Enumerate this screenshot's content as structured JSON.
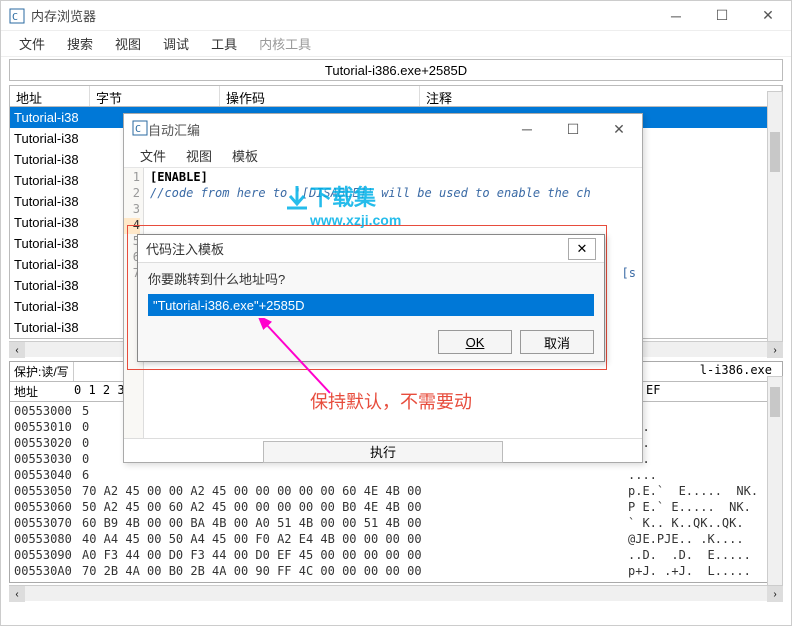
{
  "main_window": {
    "title": "内存浏览器",
    "menus": [
      "文件",
      "搜索",
      "视图",
      "调试",
      "工具",
      "内核工具"
    ],
    "subtitle": "Tutorial-i386.exe+2585D",
    "columns": {
      "addr": "地址",
      "bytes": "字节",
      "opcode": "操作码",
      "comment": "注释"
    },
    "rows": [
      "Tutorial-i38",
      "Tutorial-i38",
      "Tutorial-i38",
      "Tutorial-i38",
      "Tutorial-i38",
      "Tutorial-i38",
      "Tutorial-i38",
      "Tutorial-i38",
      "Tutorial-i38",
      "Tutorial-i38",
      "Tutorial-i38"
    ],
    "lower_header": {
      "protect": "保护:读/写",
      "addr": "地址",
      "hex_offsets_left": "0",
      "hex_path": "l-i386.exe",
      "hexhdr": "0  1  2  3  4  5  6  7  8  9  A  B  C  D  E  F",
      "asciihdr": "EF"
    },
    "hex_rows": [
      {
        "a": "00553000",
        "h": "5",
        "as": ""
      },
      {
        "a": "00553010",
        "h": "0",
        "as": ".A."
      },
      {
        "a": "00553020",
        "h": "0",
        "as": ".D."
      },
      {
        "a": "00553030",
        "h": "0",
        "as": ".D."
      },
      {
        "a": "00553040",
        "h": "6",
        "as": "...."
      },
      {
        "a": "00553050",
        "h": "70 A2 45 00 00 A2 45 00 00 00 00 00 60 4E 4B 00",
        "as": "p.E.`  E.....  NK."
      },
      {
        "a": "00553060",
        "h": "50 A2 45 00 60 A2 45 00 00 00 00 00 B0 4E 4B 00",
        "as": "P E.` E.....  NK."
      },
      {
        "a": "00553070",
        "h": "60 B9 4B 00 00 BA 4B 00 A0 51 4B 00 00 51 4B 00",
        "as": "` K.. K..QK..QK."
      },
      {
        "a": "00553080",
        "h": "40 A4 45 00 50 A4 45 00 F0 A2 E4 4B 00 00 00 00",
        "as": "@JE.PJE.. .K...."
      },
      {
        "a": "00553090",
        "h": "A0 F3 44 00 D0 F3 44 00 D0 EF 45 00 00 00 00 00",
        "as": "..D.  .D.  E....."
      },
      {
        "a": "005530A0",
        "h": "70 2B 4A 00 B0 2B 4A 00 90 FF 4C 00 00 00 00 00",
        "as": "p+J. .+J.  L....."
      }
    ]
  },
  "aa_window": {
    "title": "自动汇编",
    "menus": [
      "文件",
      "视图",
      "模板"
    ],
    "lines": {
      "l1": "[ENABLE]",
      "l2": "//code from here to '[DISABLE]' will be used to enable the ch",
      "l7": "[s"
    },
    "exec_btn": "执行"
  },
  "inj_dialog": {
    "title": "代码注入模板",
    "prompt": "你要跳转到什么地址吗?",
    "input_value": "\"Tutorial-i386.exe\"+2585D",
    "ok": "OK",
    "cancel": "取消"
  },
  "annot": {
    "text": "保持默认，不需要动"
  },
  "watermark": {
    "t1": "下载集",
    "t2": "www.xzji.com"
  }
}
